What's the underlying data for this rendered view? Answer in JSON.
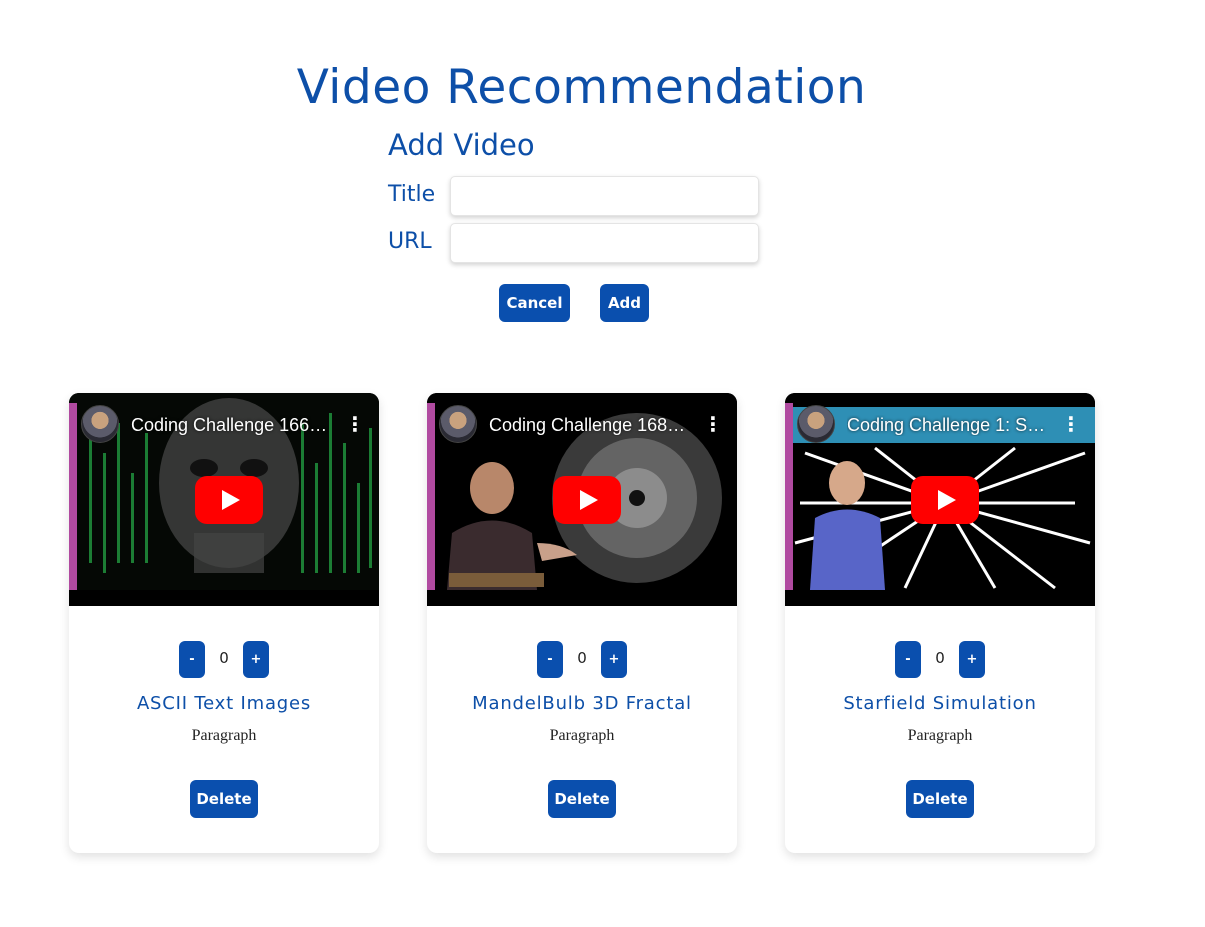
{
  "header": {
    "title": "Video Recommendation"
  },
  "form": {
    "heading": "Add Video",
    "title_label": "Title",
    "url_label": "URL",
    "title_value": "",
    "url_value": "",
    "cancel_label": "Cancel",
    "add_label": "Add"
  },
  "colors": {
    "accent": "#0a4fae",
    "play": "#ff0000"
  },
  "videos": [
    {
      "player_title": "Coding Challenge 166: …",
      "name": "ASCII Text Images",
      "votes": "0",
      "description": "Paragraph",
      "minus_label": "-",
      "plus_label": "+",
      "delete_label": "Delete",
      "more_icon": "⋮"
    },
    {
      "player_title": "Coding Challenge 168: …",
      "name": "MandelBulb 3D Fractal",
      "votes": "0",
      "description": "Paragraph",
      "minus_label": "-",
      "plus_label": "+",
      "delete_label": "Delete",
      "more_icon": "⋮"
    },
    {
      "player_title": "Coding Challenge 1: St…",
      "name": "Starfield Simulation",
      "votes": "0",
      "description": "Paragraph",
      "minus_label": "-",
      "plus_label": "+",
      "delete_label": "Delete",
      "more_icon": "⋮"
    }
  ]
}
